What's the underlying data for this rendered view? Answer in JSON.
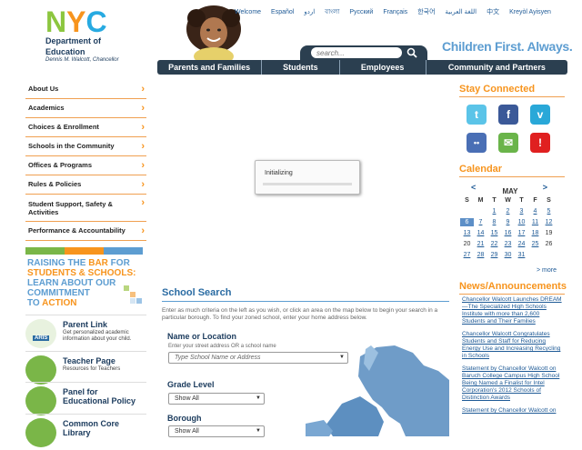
{
  "header": {
    "logo_letters": [
      "N",
      "Y",
      "C"
    ],
    "org_line1": "Department of",
    "org_line2": "Education",
    "chancellor": "Dennis M. Walcott, Chancellor",
    "languages": [
      "Welcome",
      "Español",
      "اردو",
      "বাংলা",
      "Русский",
      "Français",
      "한국어",
      "اللغة العربية",
      "中文",
      "Kreyòl Ayisyen"
    ],
    "search_placeholder": "search...",
    "tagline": "Children First. Always."
  },
  "topnav": [
    "Parents and Families",
    "Students",
    "Employees",
    "Community and Partners"
  ],
  "leftnav": [
    {
      "label": "About Us"
    },
    {
      "label": "Academics"
    },
    {
      "label": "Choices & Enrollment"
    },
    {
      "label": "Schools in the Community"
    },
    {
      "label": "Offices & Programs"
    },
    {
      "label": "Rules & Policies"
    },
    {
      "label": "Student Support, Safety & Activities"
    },
    {
      "label": "Performance & Accountability"
    }
  ],
  "colors": {
    "orange": "#f7941d",
    "green": "#7ab648",
    "blue": "#5d9dd1",
    "navy": "#2b3f50",
    "link": "#1e5a96"
  },
  "raising": {
    "l1a": "RAISING THE ",
    "l1b": "BAR",
    "l1c": " FOR",
    "l2": "STUDENTS & SCHOOLS:",
    "l3": "LEARN ABOUT OUR",
    "l4": "COMMITMENT",
    "l5a": "TO ",
    "l5b": "ACTION"
  },
  "promos": [
    {
      "title": "Parent Link",
      "desc": "Get personalized academic information about your child.",
      "badge": "ARIS"
    },
    {
      "title": "Teacher Page",
      "desc": "Resources for Teachers"
    },
    {
      "title": "Panel for Educational Policy",
      "desc": ""
    },
    {
      "title": "Common Core Library",
      "desc": ""
    }
  ],
  "loading": {
    "text": "Initializing"
  },
  "school_search": {
    "title": "School Search",
    "intro": "Enter as much criteria on the left as you wish, or click an area on the map below to begin your search in a particular borough. To find your zoned school, enter your home address below.",
    "name_label": "Name or Location",
    "name_sub": "Enter your street address OR a school name",
    "name_placeholder": "Type School Name or Address",
    "grade_label": "Grade Level",
    "grade_value": "Show All",
    "borough_label": "Borough",
    "borough_value": "Show All"
  },
  "stay_connected": {
    "title": "Stay Connected",
    "icons": [
      {
        "name": "twitter",
        "glyph": "t",
        "color": "#5bc4e8"
      },
      {
        "name": "facebook",
        "glyph": "f",
        "color": "#3b5998"
      },
      {
        "name": "vimeo",
        "glyph": "v",
        "color": "#29a8d8"
      },
      {
        "name": "flickr",
        "glyph": "••",
        "color": "#4a6fb5"
      },
      {
        "name": "email",
        "glyph": "✉",
        "color": "#6ab44a"
      },
      {
        "name": "alert",
        "glyph": "!",
        "color": "#e02020"
      }
    ]
  },
  "calendar": {
    "title": "Calendar",
    "prev": "<",
    "next": ">",
    "month": "MAY",
    "dow": [
      "S",
      "M",
      "T",
      "W",
      "T",
      "F",
      "S"
    ],
    "cells": [
      "",
      "",
      "1",
      "2",
      "3",
      "4",
      "5",
      "6",
      "7",
      "8",
      "9",
      "10",
      "11",
      "12",
      "13",
      "14",
      "15",
      "16",
      "17",
      "18",
      "19",
      "20",
      "21",
      "22",
      "23",
      "24",
      "25",
      "26",
      "27",
      "28",
      "29",
      "30",
      "31",
      "",
      ""
    ],
    "today": "6",
    "unlinked": [
      "19",
      "20",
      "26"
    ],
    "more": "> more"
  },
  "news": {
    "title": "News/Announcements",
    "items": [
      "Chancellor Walcott Launches DREAM—The Specialized High Schools Institute with more than 2,600 Students and Their Families",
      "Chancellor Walcott Congratulates Students and Staff for Reducing Energy Use and Increasing Recycling in Schools",
      "Statement by Chancellor Walcott on Baruch College Campus High School Being Named a Finalist for Intel Corporation's 2012 Schools of Distinction Awards",
      "Statement by Chancellor Walcott on"
    ]
  }
}
